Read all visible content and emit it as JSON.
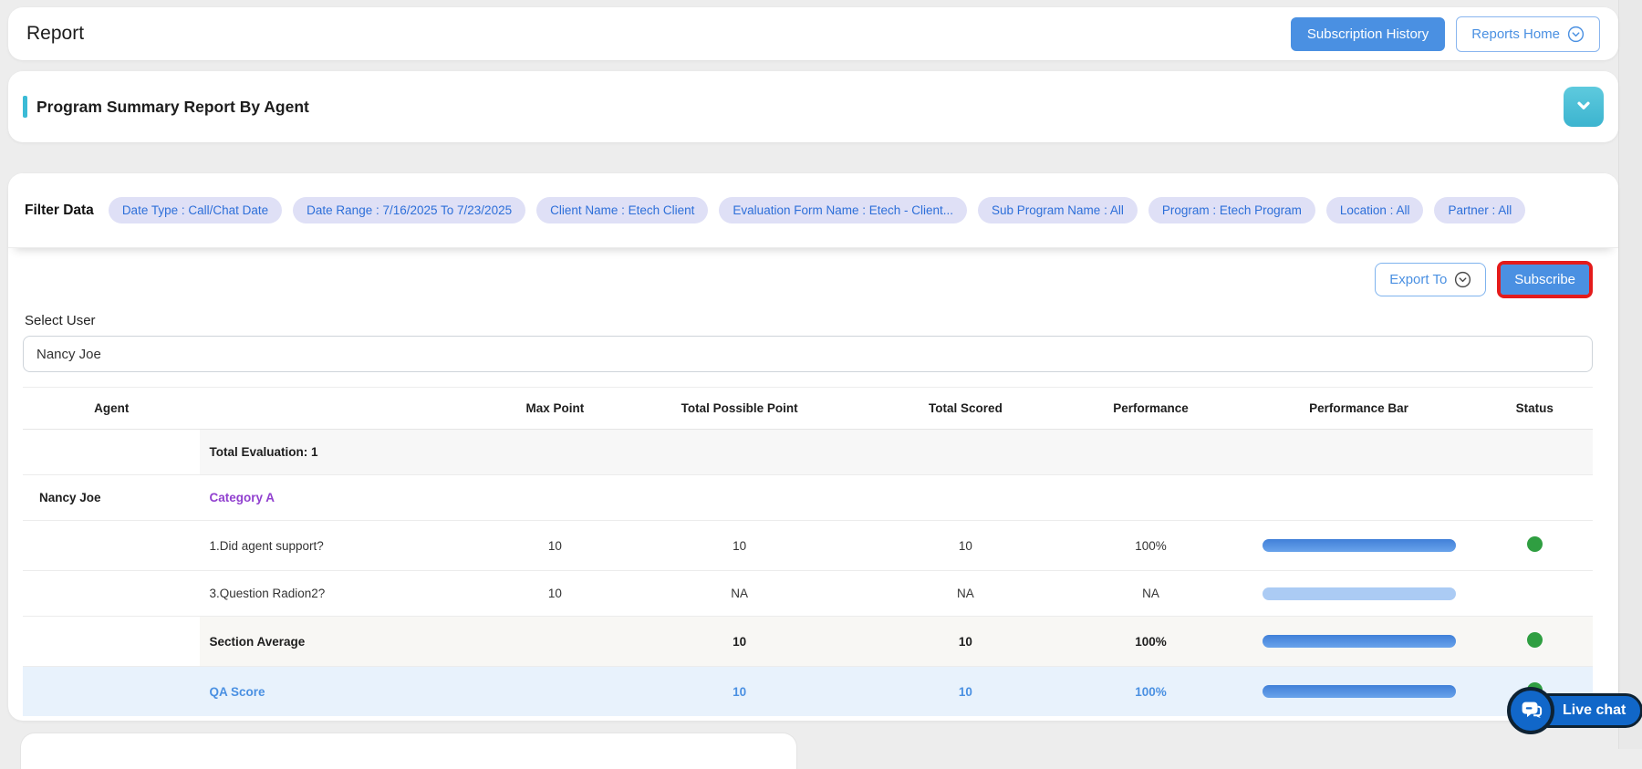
{
  "header": {
    "title": "Report",
    "subscription_history_label": "Subscription History",
    "reports_home_label": "Reports Home"
  },
  "section": {
    "title": "Program Summary Report By Agent"
  },
  "filters": {
    "label": "Filter Data",
    "chips": [
      "Date Type : Call/Chat Date",
      "Date Range : 7/16/2025 To 7/23/2025",
      "Client Name : Etech Client",
      "Evaluation Form Name : Etech - Client...",
      "Sub Program Name : All",
      "Program : Etech Program",
      "Location : All",
      "Partner : All"
    ]
  },
  "actions": {
    "export_label": "Export To",
    "subscribe_label": "Subscribe"
  },
  "user_select": {
    "label": "Select User",
    "value": "Nancy Joe"
  },
  "table": {
    "columns": [
      "Agent",
      "Max Point",
      "Total Possible Point",
      "Total Scored",
      "Performance",
      "Performance Bar",
      "Status"
    ],
    "total_evaluation_label": "Total Evaluation: 1",
    "agent_name": "Nancy Joe",
    "category_label": "Category A",
    "rows": [
      {
        "label": "1.Did agent support?",
        "max_point": "10",
        "total_possible_point": "10",
        "total_scored": "10",
        "performance": "100%",
        "bar": "filled",
        "bar_percent": 100,
        "status": "green"
      },
      {
        "label": "3.Question Radion2?",
        "max_point": "10",
        "total_possible_point": "NA",
        "total_scored": "NA",
        "performance": "NA",
        "bar": "na",
        "bar_percent": 100,
        "status": "none"
      }
    ],
    "section_average": {
      "label": "Section Average",
      "max_point": "",
      "total_possible_point": "10",
      "total_scored": "10",
      "performance": "100%",
      "bar": "filled",
      "status": "green"
    },
    "qa_score": {
      "label": "QA Score",
      "total_possible_point": "10",
      "total_scored": "10",
      "performance": "100%",
      "bar": "filled",
      "status": "green"
    }
  },
  "live_chat": {
    "label": "Live chat"
  },
  "colors": {
    "accent_blue": "#4a90e2",
    "teal": "#3bbbd6",
    "chip_bg": "#dfe0f6",
    "chip_text": "#2d6fd9",
    "category_purple": "#9140cf",
    "status_green": "#2f9e41",
    "bar_blue": "#4180d8",
    "bar_na": "#abcbf4",
    "highlight_red": "#e41b1b",
    "live_chat_blue": "#1167c9"
  }
}
